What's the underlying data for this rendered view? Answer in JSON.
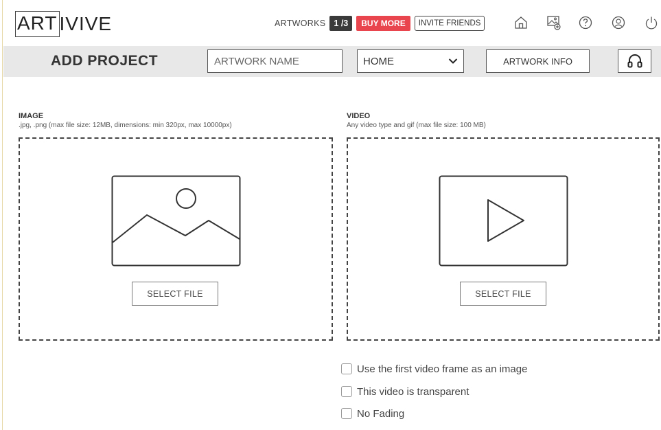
{
  "logo": {
    "boxed": "ART",
    "rest": "IVIVE"
  },
  "header": {
    "artworks_label": "ARTWORKS",
    "artworks_count": "1 /3",
    "buy_more_label": "BUY MORE",
    "invite_label": "INVITE FRIENDS",
    "icons": [
      "home-icon",
      "gallery-add-icon",
      "help-icon",
      "user-icon",
      "power-icon"
    ]
  },
  "toolbar": {
    "title": "ADD PROJECT",
    "artwork_name_placeholder": "ARTWORK NAME",
    "category_selected": "HOME",
    "artwork_info_label": "ARTWORK INFO",
    "headset_icon": "headset-icon"
  },
  "image_section": {
    "title": "IMAGE",
    "hint": ".jpg, .png (max file size: 12MB, dimensions: min 320px, max 10000px)",
    "select_label": "SELECT FILE",
    "icon": "image-placeholder-icon"
  },
  "video_section": {
    "title": "VIDEO",
    "hint": "Any video type and gif (max file size: 100 MB)",
    "select_label": "SELECT FILE",
    "icon": "video-play-icon"
  },
  "options": [
    {
      "label": "Use the first video frame as an image",
      "checked": false
    },
    {
      "label": "This video is transparent",
      "checked": false
    },
    {
      "label": "No Fading",
      "checked": false
    }
  ],
  "colors": {
    "accent": "#e8454f",
    "badge": "#3a3a3a",
    "toolbar_bg": "#e8e8e8"
  }
}
